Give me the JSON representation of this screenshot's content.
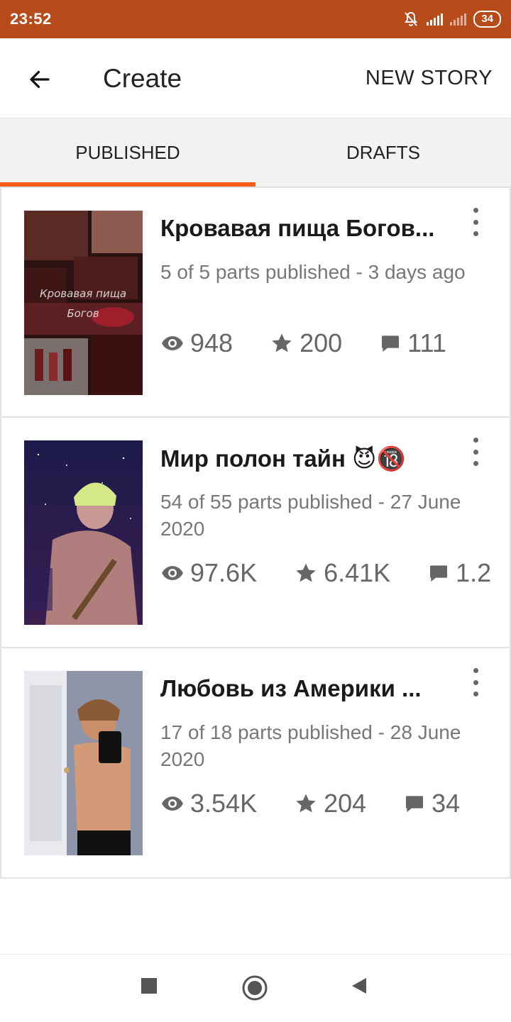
{
  "status_bar": {
    "time": "23:52",
    "battery": "34"
  },
  "app_bar": {
    "title": "Create",
    "new_story_label": "NEW STORY"
  },
  "tabs": [
    {
      "label": "PUBLISHED",
      "active": true
    },
    {
      "label": "DRAFTS",
      "active": false
    }
  ],
  "stories": [
    {
      "title": "Кровавая пища Богов...",
      "meta": "5 of 5 parts published - 3 days ago",
      "reads": "948",
      "votes": "200",
      "comments": "111",
      "cover_text": "Кровавая пища Богов"
    },
    {
      "title": "Мир полон тайн 😈🔞",
      "meta": "54 of 55 parts published - 27 June 2020",
      "reads": "97.6K",
      "votes": "6.41K",
      "comments": "1.2"
    },
    {
      "title": "Любовь из Америки ...",
      "meta": "17 of 18 parts published - 28 June 2020",
      "reads": "3.54K",
      "votes": "204",
      "comments": "34"
    }
  ],
  "icons": {
    "back": "arrow-left-icon",
    "reads": "eye-icon",
    "votes": "star-icon",
    "comments": "comment-icon",
    "more": "kebab-icon",
    "nav_recent": "square-icon",
    "nav_home": "circle-icon",
    "nav_back": "triangle-icon"
  },
  "colors": {
    "status_bar": "#b84b1c",
    "accent": "#ff5c1a"
  }
}
